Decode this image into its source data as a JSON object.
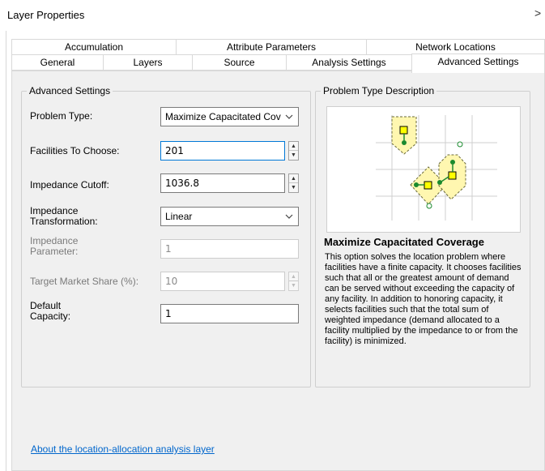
{
  "window": {
    "title": "Layer Properties",
    "close_glyph": ">"
  },
  "tabs": {
    "row1": [
      {
        "label": "Accumulation"
      },
      {
        "label": "Attribute Parameters"
      },
      {
        "label": "Network Locations"
      }
    ],
    "row2": [
      {
        "label": "General"
      },
      {
        "label": "Layers"
      },
      {
        "label": "Source"
      },
      {
        "label": "Analysis Settings"
      },
      {
        "label": "Advanced Settings",
        "active": true
      }
    ]
  },
  "advanced": {
    "group_label": "Advanced Settings",
    "problem_type": {
      "label": "Problem Type:",
      "value": "Maximize Capacitated Cov"
    },
    "facilities": {
      "label": "Facilities To Choose:",
      "value": "201"
    },
    "impedance_cutoff": {
      "label": "Impedance Cutoff:",
      "value": "1036.8"
    },
    "impedance_transformation": {
      "label_line1": "Impedance",
      "label_line2": "Transformation:",
      "value": "Linear"
    },
    "impedance_parameter": {
      "label_line1": "Impedance",
      "label_line2": "Parameter:",
      "value": "1"
    },
    "target_market_share": {
      "label": "Target Market Share (%):",
      "value": "10"
    },
    "default_capacity": {
      "label_line1": "Default",
      "label_line2": "Capacity:",
      "value": "1"
    }
  },
  "description": {
    "group_label": "Problem Type Description",
    "title": "Maximize Capacitated Coverage",
    "text": "This option solves the location problem where facilities have a finite capacity. It chooses facilities such that all or the greatest amount of demand can be served without exceeding the capacity of any facility. In addition to honoring capacity, it selects facilities such that the total sum of weighted impedance (demand allocated to a facility multiplied by the impedance to or from the facility) is minimized."
  },
  "footer": {
    "link": "About the location-allocation analysis layer"
  },
  "colors": {
    "accent": "#0078d7",
    "link": "#0066cc",
    "facility": "#ffff00",
    "demand": "#1a8a2e",
    "zone": "#fff7b0"
  }
}
